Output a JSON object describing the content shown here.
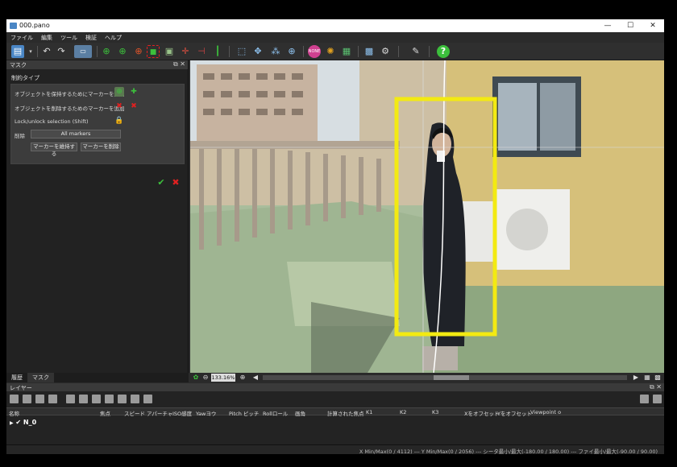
{
  "window": {
    "title": "000.pano"
  },
  "window_controls": {
    "minimize": "—",
    "maximize": "☐",
    "close": "✕"
  },
  "menu": [
    "ファイル",
    "編集",
    "ツール",
    "検証",
    "ヘルプ"
  ],
  "mask_panel": {
    "title": "マスク",
    "section_title": "制約タイプ",
    "rows": [
      "オブジェクトを保持するためにマーカーを追加",
      "オブジェクトを削除するためのマーカーを追加",
      "Lock/unlock selection (Shift)"
    ],
    "delete_label": "削除",
    "all_markers": "All markers",
    "keep_markers": "マーカーを維持する",
    "remove_markers": "マーカーを削除"
  },
  "bottom_tabs": [
    "履歴",
    "マスク"
  ],
  "zoom": "133.16%",
  "layer_panel": {
    "title": "レイヤー",
    "columns": [
      "名称",
      "焦点",
      "スピード",
      "アパーチャ",
      "ISO感度",
      "Yawヨウ",
      "Pitch ピッチ",
      "Rollロール",
      "画角",
      "計算された焦点",
      "K1",
      "K2",
      "K3",
      "Xをオフセット",
      "Yをオフセット",
      "Viewpoint o"
    ],
    "row": "N_0"
  },
  "status": "X Min/Max(0 / 4112)  ---  Y Min/Max(0 / 2056)  ---  シータ最小/最大(-180.00 / 180.00)  ---  ファイ最小/最大(-90.00 / 90.00)",
  "colors": {
    "accent_green": "#3cbf3c",
    "remove_red": "#e02020",
    "selection_yellow": "#f3ea12"
  }
}
